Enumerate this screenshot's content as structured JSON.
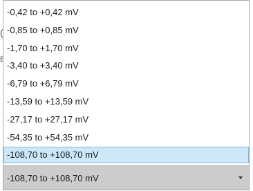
{
  "dropdown": {
    "options": [
      {
        "label": "-0,42 to +0,42 mV"
      },
      {
        "label": "-0,85 to +0,85 mV"
      },
      {
        "label": "-1,70 to +1,70 mV"
      },
      {
        "label": "-3,40 to +3,40 mV"
      },
      {
        "label": "-6,79 to +6,79 mV"
      },
      {
        "label": "-13,59 to +13,59 mV"
      },
      {
        "label": "-27,17 to +27,17 mV"
      },
      {
        "label": "-54,35 to +54,35 mV"
      },
      {
        "label": "-108,70 to +108,70 mV",
        "selected": true
      }
    ],
    "selected_value": "-108,70 to +108,70 mV",
    "arrow_icon": "chevron-down-icon"
  },
  "background": {
    "glyph_1": "(",
    "glyph_2": "E"
  },
  "colors": {
    "selected_background": "#cce8f7",
    "selected_border": "#7fb8dc",
    "combo_background": "#cccccc"
  }
}
